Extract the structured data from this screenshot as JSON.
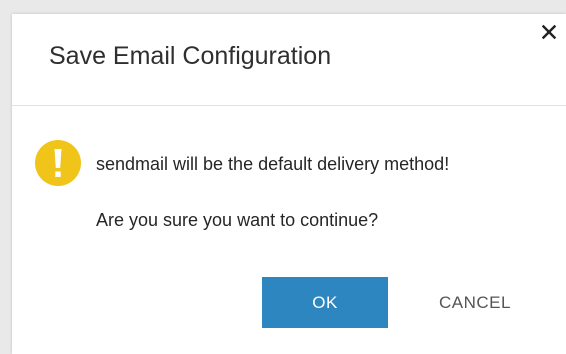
{
  "dialog": {
    "title": "Save Email Configuration",
    "close_icon": "close-icon",
    "warning_icon": "exclamation-icon",
    "message_line_1": "sendmail will be the default delivery method!",
    "message_line_2": "Are you sure you want to continue?",
    "ok_label": "OK",
    "cancel_label": "CANCEL"
  },
  "colors": {
    "primary_button": "#2e86c1",
    "warning": "#f0c419",
    "title_text": "#2f2f2f",
    "body_text": "#262626",
    "secondary_text": "#555555"
  }
}
